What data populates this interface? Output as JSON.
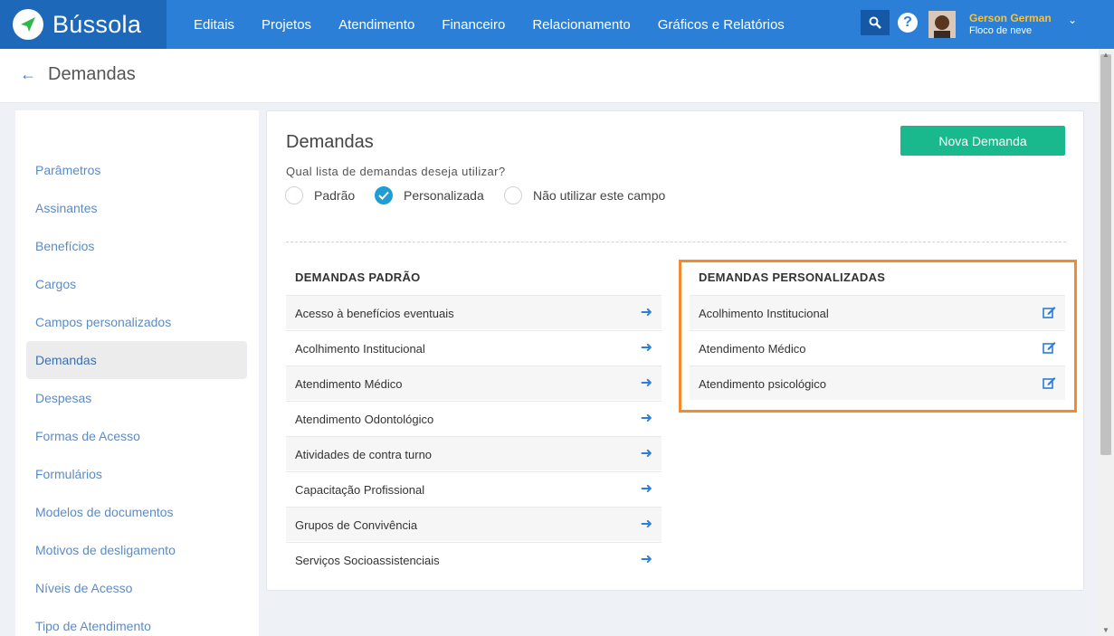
{
  "app": {
    "logo_text": "Bússola"
  },
  "nav": {
    "items": [
      {
        "label": "Editais"
      },
      {
        "label": "Projetos"
      },
      {
        "label": "Atendimento"
      },
      {
        "label": "Financeiro"
      },
      {
        "label": "Relacionamento"
      },
      {
        "label": "Gráficos e Relatórios"
      }
    ]
  },
  "user": {
    "name": "Gerson German",
    "subtitle": "Floco de neve"
  },
  "header": {
    "title": "Demandas"
  },
  "sidebar": {
    "items": [
      {
        "label": "Parâmetros"
      },
      {
        "label": "Assinantes"
      },
      {
        "label": "Benefícios"
      },
      {
        "label": "Cargos"
      },
      {
        "label": "Campos personalizados"
      },
      {
        "label": "Demandas"
      },
      {
        "label": "Despesas"
      },
      {
        "label": "Formas de Acesso"
      },
      {
        "label": "Formulários"
      },
      {
        "label": "Modelos de documentos"
      },
      {
        "label": "Motivos de desligamento"
      },
      {
        "label": "Níveis de Acesso"
      },
      {
        "label": "Tipo de Atendimento"
      }
    ],
    "active_label": "Demandas"
  },
  "main": {
    "title": "Demandas",
    "new_button": "Nova Demanda",
    "question": "Qual lista de demandas deseja utilizar?",
    "options": [
      {
        "label": "Padrão",
        "checked": false
      },
      {
        "label": "Personalizada",
        "checked": true
      },
      {
        "label": "Não utilizar este campo",
        "checked": false
      }
    ],
    "default_list": {
      "heading": "DEMANDAS PADRÃO",
      "items": [
        "Acesso à benefícios eventuais",
        "Acolhimento Institucional",
        "Atendimento Médico",
        "Atendimento Odontológico",
        "Atividades de contra turno",
        "Capacitação Profissional",
        "Grupos de Convivência",
        "Serviços Socioassistenciais"
      ]
    },
    "custom_list": {
      "heading": "DEMANDAS PERSONALIZADAS",
      "items": [
        "Acolhimento Institucional",
        "Atendimento Médico",
        "Atendimento psicológico"
      ]
    }
  },
  "colors": {
    "topbar": "#2b7fd6",
    "logo_bg": "#1d68b8",
    "primary_button": "#1ab98d",
    "check": "#1e9ed3",
    "highlight": "#f28a2e",
    "user_name": "#f5c242"
  }
}
